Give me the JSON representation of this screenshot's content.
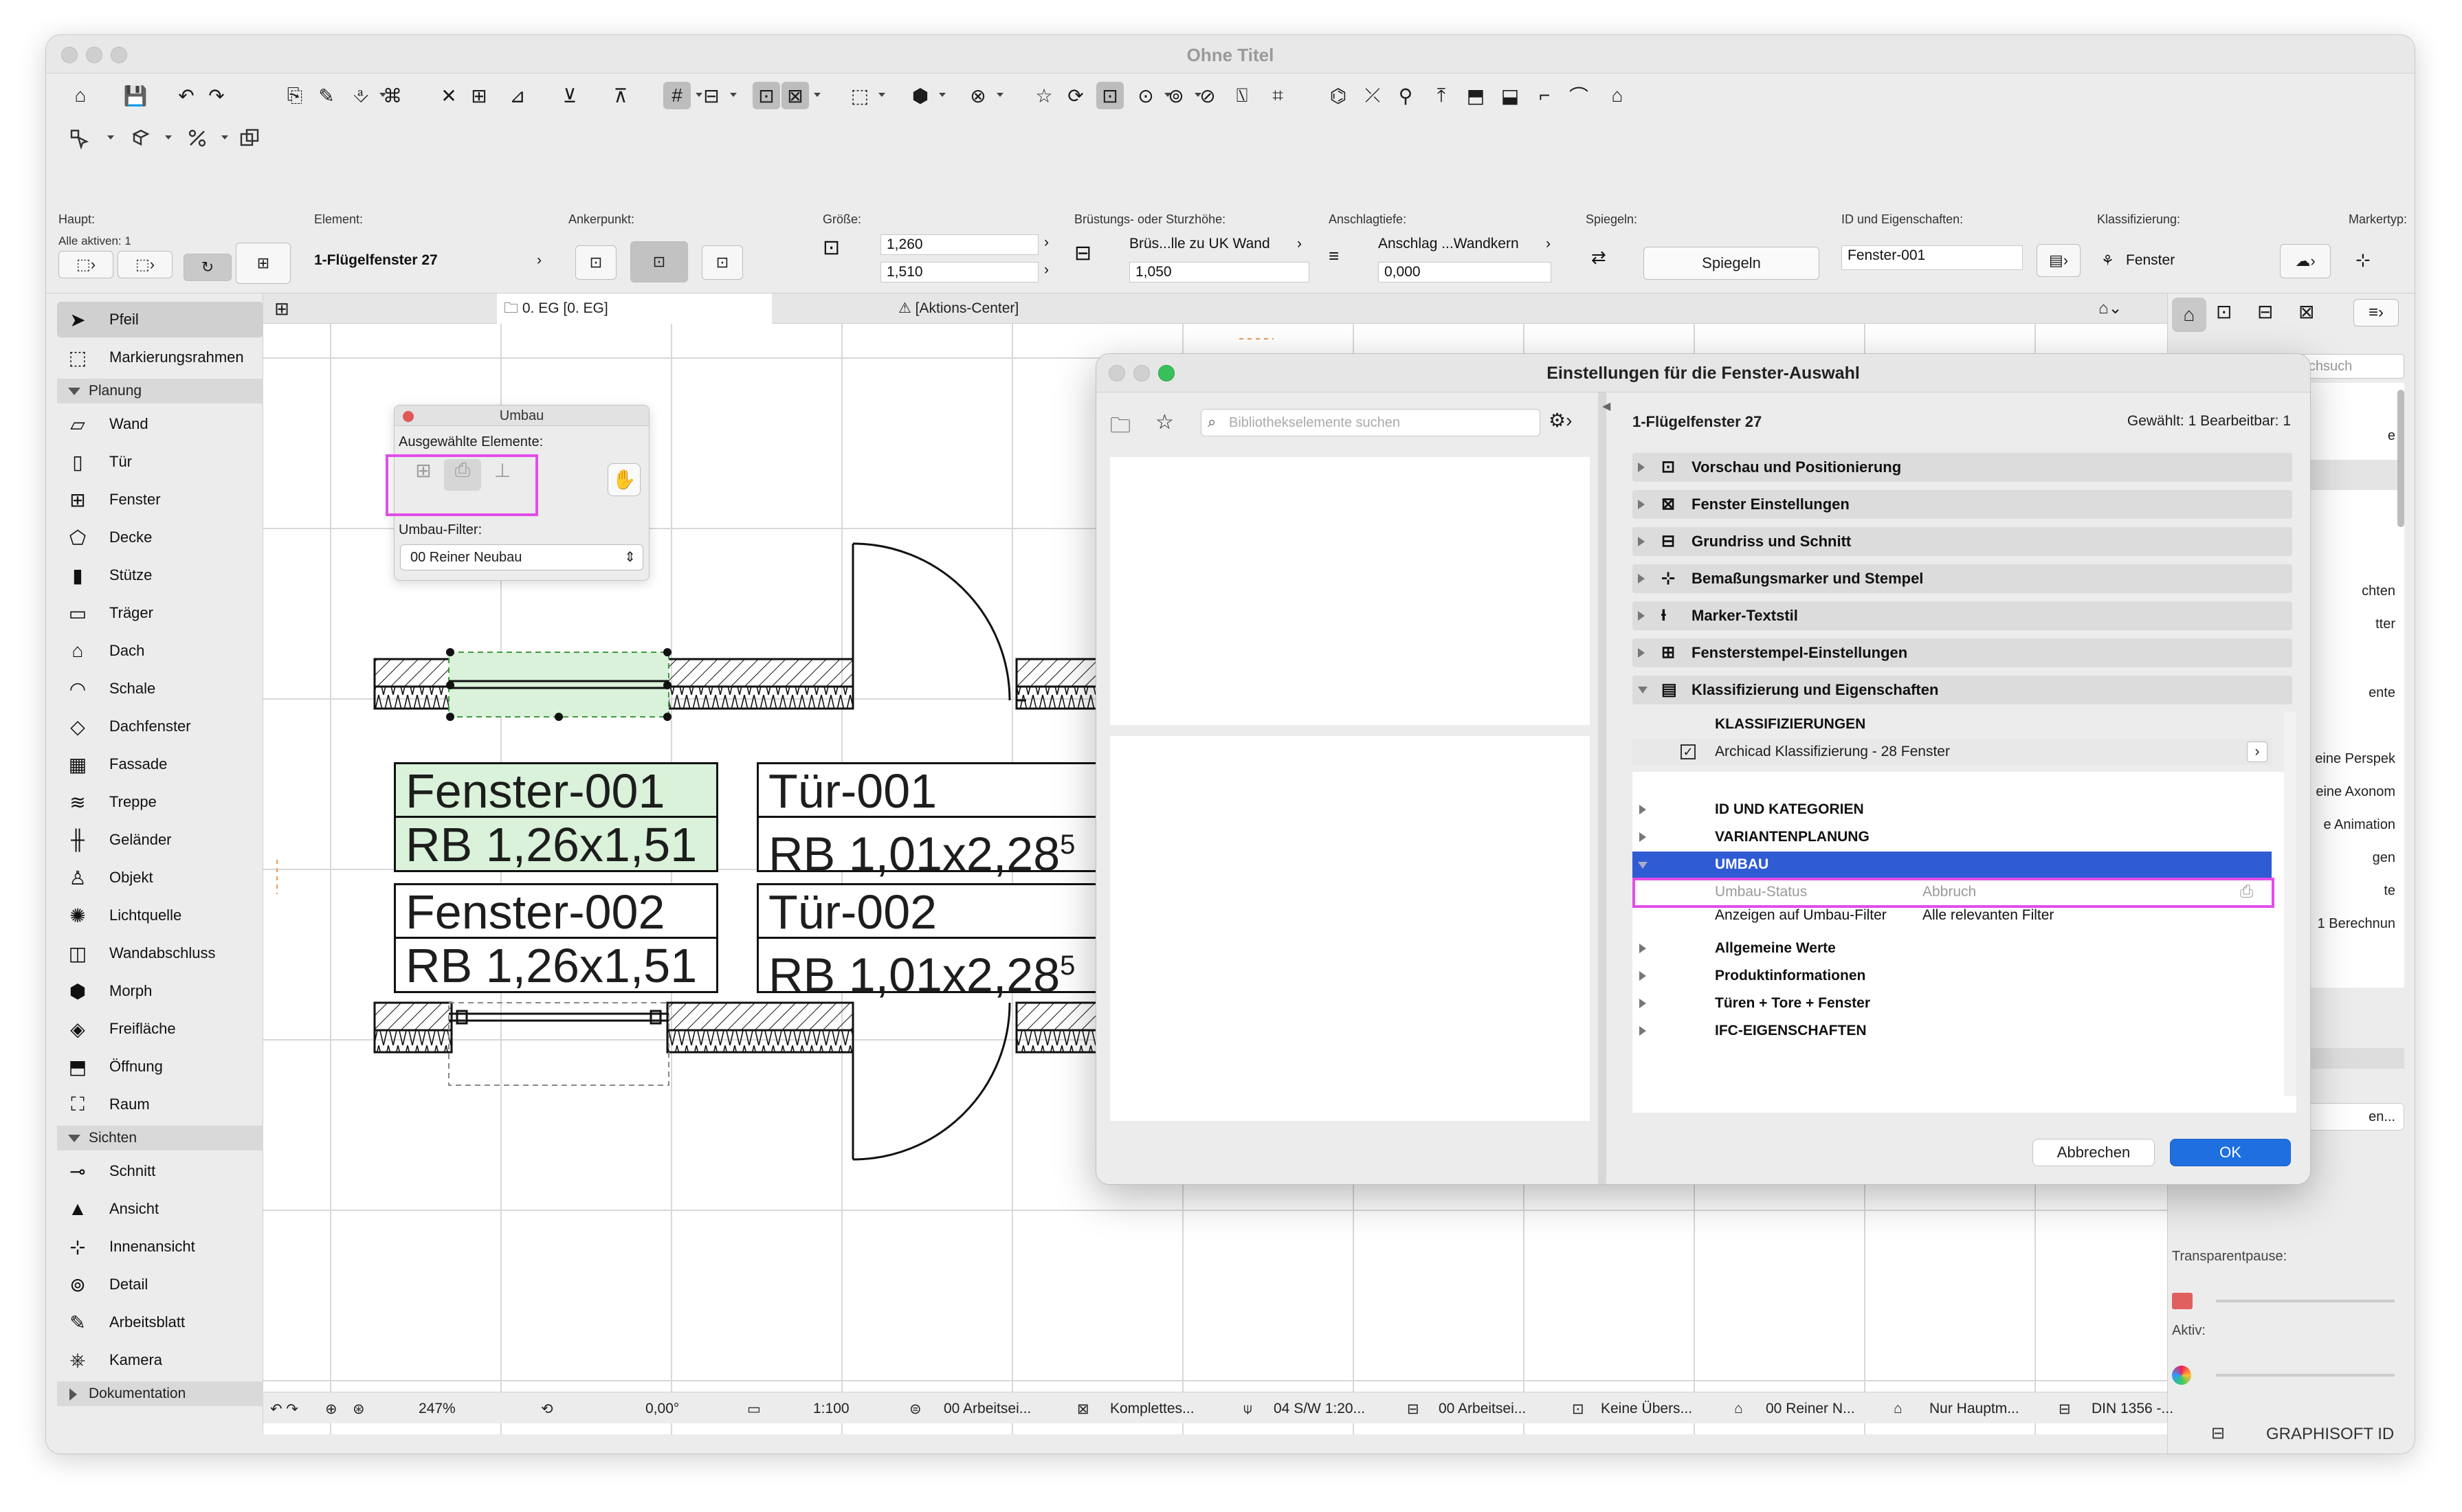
{
  "window": {
    "title": "Ohne Titel"
  },
  "toolbar": {
    "icons": [
      "home-icon",
      "save-icon",
      "undo-icon",
      "redo-icon",
      "pick-up-parameters-icon",
      "eyedropper-icon",
      "inject-parameters-icon",
      "magic-wand-icon",
      "cursor-snap-icon",
      "grid-snap-icon",
      "guide-lines-icon",
      "snap-guides-icon",
      "snap-points-icon",
      "grid-icon",
      "slab-tool-icon",
      "selection-icon",
      "lock-icon",
      "fill-icon",
      "3d-view-icon",
      "layers-icon",
      "favorites-icon",
      "renovation-icon",
      "select-mode-icon",
      "trace-icon",
      "cursor-icon",
      "dimension-icon",
      "tags-icon",
      "marquee-icon",
      "solid-icon",
      "split-icon",
      "magnet-icon",
      "align-icon",
      "stretch-icon",
      "explode-icon",
      "curve-icon",
      "fillet-icon",
      "roof-icon"
    ]
  },
  "info_box": {
    "haupt_label": "Haupt:",
    "alle_aktiven": "Alle aktiven: 1",
    "element_label": "Element:",
    "element_value": "1-Flügelfenster 27",
    "anker_label": "Ankerpunkt:",
    "groesse_label": "Größe:",
    "width": "1,260",
    "height": "1,510",
    "bruestung_label": "Brüstungs- oder Sturzhöhe:",
    "bruestung_value": "Brüs...lle zu UK Wand",
    "bruestung_num": "1,050",
    "anschlag_label": "Anschlagtiefe:",
    "anschlag_value": "Anschlag ...Wandkern",
    "anschlag_num": "0,000",
    "spiegeln_label": "Spiegeln:",
    "spiegeln_button": "Spiegeln",
    "id_label": "ID und Eigenschaften:",
    "id_value": "Fenster-001",
    "klass_label": "Klassifizierung:",
    "klass_value": "Fenster",
    "marker_label": "Markertyp:"
  },
  "tabs": {
    "plan": "0. EG [0. EG]",
    "action": "[Aktions-Center]"
  },
  "toolbox": {
    "items_top": [
      {
        "label": "Pfeil",
        "icon": "arrow-icon"
      },
      {
        "label": "Markierungsrahmen",
        "icon": "marquee-icon"
      }
    ],
    "planung_header": "Planung",
    "planung": [
      {
        "label": "Wand",
        "icon": "wall-icon"
      },
      {
        "label": "Tür",
        "icon": "door-icon"
      },
      {
        "label": "Fenster",
        "icon": "window-icon"
      },
      {
        "label": "Decke",
        "icon": "slab-icon"
      },
      {
        "label": "Stütze",
        "icon": "column-icon"
      },
      {
        "label": "Träger",
        "icon": "beam-icon"
      },
      {
        "label": "Dach",
        "icon": "roof-icon"
      },
      {
        "label": "Schale",
        "icon": "shell-icon"
      },
      {
        "label": "Dachfenster",
        "icon": "skylight-icon"
      },
      {
        "label": "Fassade",
        "icon": "curtain-wall-icon"
      },
      {
        "label": "Treppe",
        "icon": "stair-icon"
      },
      {
        "label": "Geländer",
        "icon": "railing-icon"
      },
      {
        "label": "Objekt",
        "icon": "object-icon"
      },
      {
        "label": "Lichtquelle",
        "icon": "lamp-icon"
      },
      {
        "label": "Wandabschluss",
        "icon": "wall-end-icon"
      },
      {
        "label": "Morph",
        "icon": "morph-icon"
      },
      {
        "label": "Freifläche",
        "icon": "mesh-icon"
      },
      {
        "label": "Öffnung",
        "icon": "opening-icon"
      },
      {
        "label": "Raum",
        "icon": "zone-icon"
      }
    ],
    "sichten_header": "Sichten",
    "sichten": [
      {
        "label": "Schnitt",
        "icon": "section-icon"
      },
      {
        "label": "Ansicht",
        "icon": "elevation-icon"
      },
      {
        "label": "Innenansicht",
        "icon": "interior-elevation-icon"
      },
      {
        "label": "Detail",
        "icon": "detail-icon"
      },
      {
        "label": "Arbeitsblatt",
        "icon": "worksheet-icon"
      },
      {
        "label": "Kamera",
        "icon": "camera-icon"
      }
    ],
    "doku_header": "Dokumentation"
  },
  "umbau_palette": {
    "title": "Umbau",
    "selected_label": "Ausgewählte Elemente:",
    "filter_label": "Umbau-Filter:",
    "filter_value": "00 Reiner Neubau"
  },
  "plan_labels": [
    {
      "id": "Fenster-001",
      "dim": "RB  1,26x1,51",
      "sup": ""
    },
    {
      "id": "Tür-001",
      "dim": "RB  1,01x2,28",
      "sup": "5"
    },
    {
      "id": "Fenster-002",
      "dim": "RB  1,26x1,51",
      "sup": ""
    },
    {
      "id": "Tür-002",
      "dim": "RB  1,01x2,28",
      "sup": "5"
    }
  ],
  "dialog": {
    "title": "Einstellungen für die Fenster-Auswahl",
    "search_placeholder": "Bibliothekselemente suchen",
    "object_name": "1-Flügelfenster 27",
    "selection_info": "Gewählt: 1 Bearbeitbar: 1",
    "panels": [
      "Vorschau und Positionierung",
      "Fenster Einstellungen",
      "Grundriss und Schnitt",
      "Bemaßungsmarker und Stempel",
      "Marker-Textstil",
      "Fensterstempel-Einstellungen",
      "Klassifizierung und Eigenschaften"
    ],
    "klass_header": "KLASSIFIZIERUNGEN",
    "klass_row": "Archicad Klassifizierung - 28 Fenster",
    "prop_groups_top": [
      "ID UND KATEGORIEN",
      "VARIANTENPLANUNG"
    ],
    "umbau_group": "UMBAU",
    "umbau_status_label": "Umbau-Status",
    "umbau_status_value": "Abbruch",
    "umbau_filter_label": "Anzeigen auf Umbau-Filter",
    "umbau_filter_value": "Alle relevanten Filter",
    "prop_groups_bottom": [
      "Allgemeine Werte",
      "Produktinformationen",
      "Türen + Tore + Fenster",
      "IFC-EIGENSCHAFTEN"
    ],
    "cancel": "Abbrechen",
    "ok": "OK"
  },
  "right_panel": {
    "search_placeholder": "Projektmappe durchsuch",
    "items": [
      "e",
      "chten",
      "tter",
      "ente",
      "eine Perspek",
      "eine Axonom",
      "e Animation",
      "gen",
      "te",
      "1 Berechnun",
      "en..."
    ],
    "transparent_label": "Transparentpause:",
    "aktiv_label": "Aktiv:"
  },
  "status_bar": {
    "zoom": "247%",
    "angle": "0,00°",
    "scale": "1:100",
    "layer_combo": "00 Arbeitsei...",
    "model_view": "Komplettes...",
    "pen_set": "04 S/W 1:20...",
    "dimension": "00 Arbeitsei...",
    "override": "Keine Übers...",
    "renovation": "00 Reiner N...",
    "structure": "Nur Hauptm...",
    "din": "DIN 1356 -..."
  },
  "brand": "GRAPHISOFT ID",
  "colors": {
    "highlight": "#e24de8",
    "selection_green": "#d9f2d9",
    "accent_blue": "#1f6fe0",
    "umbau_row": "#2f5bd3"
  }
}
